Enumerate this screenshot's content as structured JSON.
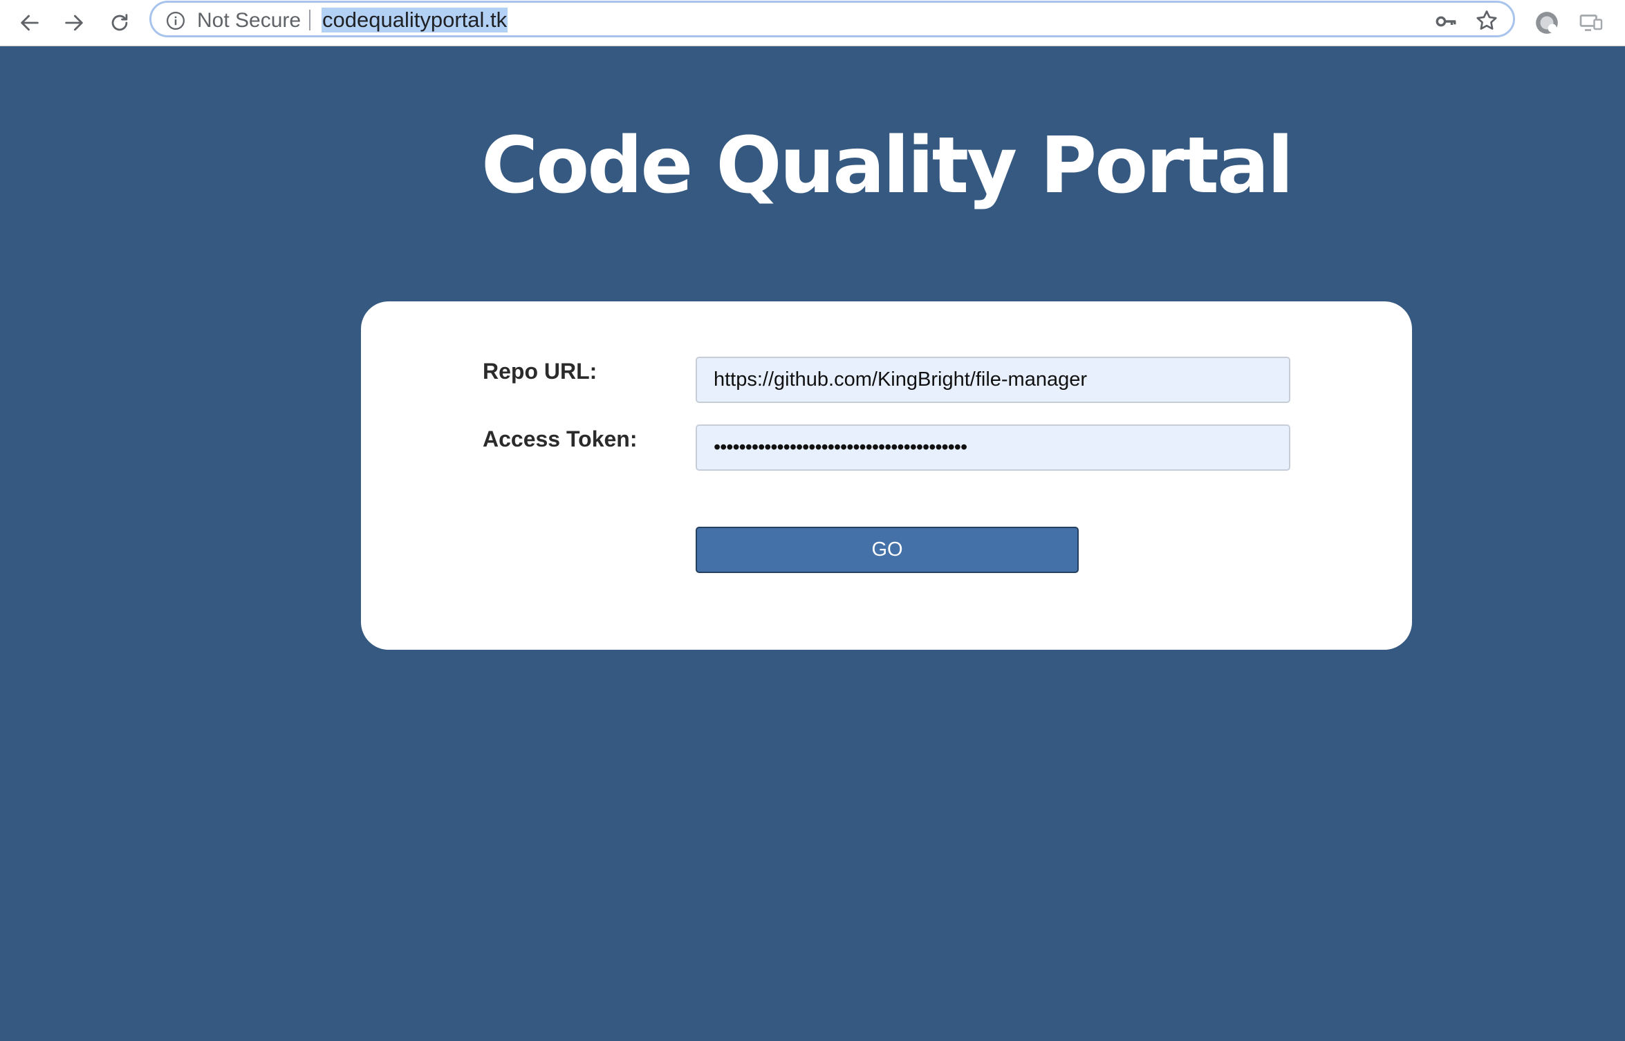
{
  "browser": {
    "security_label": "Not Secure",
    "url": "codequalityportal.tk"
  },
  "page": {
    "title": "Code Quality Portal"
  },
  "form": {
    "repo_url_label": "Repo URL:",
    "repo_url_value": "https://github.com/KingBright/file-manager",
    "access_token_label": "Access Token:",
    "access_token_value": "••••••••••••••••••••••••••••••••••••••••",
    "go_label": "GO"
  },
  "colors": {
    "page_background": "#365981",
    "button_background": "#4472a8",
    "input_background": "#e8f0fe"
  },
  "icons": {
    "back": "back-arrow-icon",
    "forward": "forward-arrow-icon",
    "reload": "reload-icon",
    "info": "info-icon",
    "key": "key-icon",
    "star": "star-icon",
    "profile": "profile-icon",
    "cast": "cast-icon"
  }
}
